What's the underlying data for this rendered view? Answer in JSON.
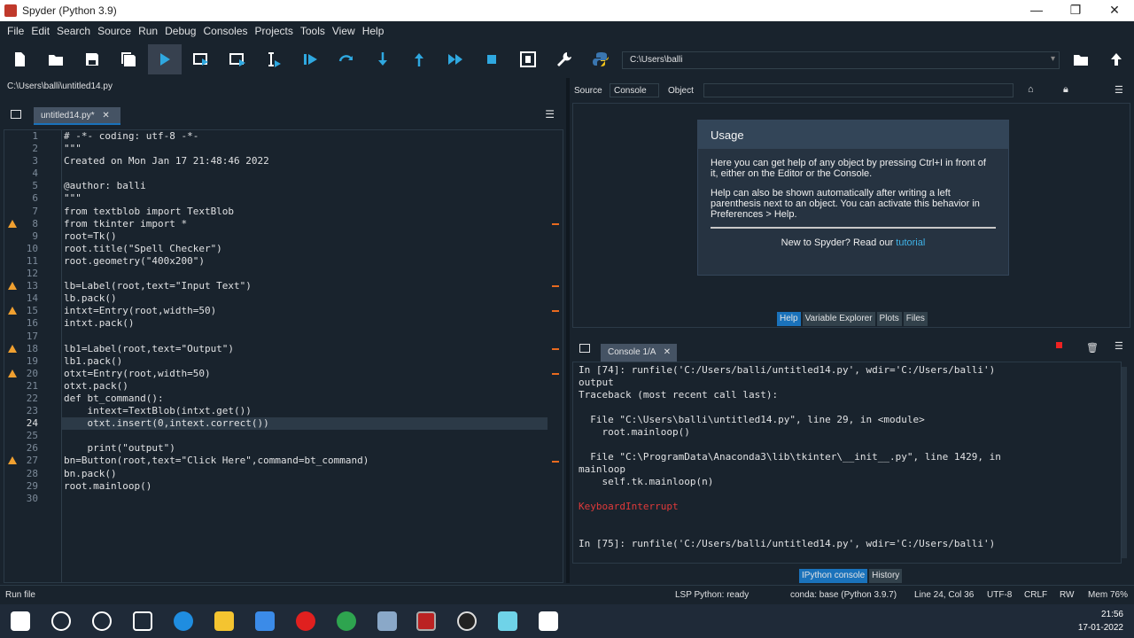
{
  "window": {
    "title": "Spyder (Python 3.9)",
    "minimize": "—",
    "maximize": "❐",
    "close": "✕"
  },
  "menu": [
    "File",
    "Edit",
    "Search",
    "Source",
    "Run",
    "Debug",
    "Consoles",
    "Projects",
    "Tools",
    "View",
    "Help"
  ],
  "toolbar": {
    "working_dir": "C:\\Users\\balli"
  },
  "editor": {
    "file_path": "C:\\Users\\balli\\untitled14.py",
    "tab_label": "untitled14.py*",
    "lines": [
      "# -*- coding: utf-8 -*-",
      "\"\"\"",
      "Created on Mon Jan 17 21:48:46 2022",
      "",
      "@author: balli",
      "\"\"\"",
      "from textblob import TextBlob",
      "from tkinter import *",
      "root=Tk()",
      "root.title(\"Spell Checker\")",
      "root.geometry(\"400x200\")",
      "",
      "lb=Label(root,text=\"Input Text\")",
      "lb.pack()",
      "intxt=Entry(root,width=50)",
      "intxt.pack()",
      "",
      "lb1=Label(root,text=\"Output\")",
      "lb1.pack()",
      "otxt=Entry(root,width=50)",
      "otxt.pack()",
      "def bt_command():",
      "    intext=TextBlob(intxt.get())",
      "    otxt.insert(0,intext.correct())",
      "",
      "    print(\"output\")",
      "bn=Button(root,text=\"Click Here\",command=bt_command)",
      "bn.pack()",
      "root.mainloop()",
      ""
    ]
  },
  "help": {
    "source_label": "Source",
    "source_value": "Console",
    "object_label": "Object",
    "usage_title": "Usage",
    "usage_p1": "Here you can get help of any object by pressing Ctrl+I in front of it, either on the Editor or the Console.",
    "usage_p2": "Help can also be shown automatically after writing a left parenthesis next to an object. You can activate this behavior in Preferences > Help.",
    "new_text": "New to Spyder? Read our ",
    "tutorial_link": "tutorial",
    "tabs": [
      "Help",
      "Variable Explorer",
      "Plots",
      "Files"
    ]
  },
  "console": {
    "tab_label": "Console 1/A",
    "lines": [
      "In [74]: runfile('C:/Users/balli/untitled14.py', wdir='C:/Users/balli')",
      "output",
      "Traceback (most recent call last):",
      "",
      "  File \"C:\\Users\\balli\\untitled14.py\", line 29, in <module>",
      "    root.mainloop()",
      "",
      "  File \"C:\\ProgramData\\Anaconda3\\lib\\tkinter\\__init__.py\", line 1429, in",
      "mainloop",
      "    self.tk.mainloop(n)",
      "",
      "KeyboardInterrupt",
      "",
      "",
      "In [75]: runfile('C:/Users/balli/untitled14.py', wdir='C:/Users/balli')"
    ],
    "tabs": [
      "IPython console",
      "History"
    ]
  },
  "status": {
    "left": "Run file",
    "lsp": "LSP Python: ready",
    "conda": "conda: base (Python 3.9.7)",
    "pos": "Line 24, Col 36",
    "enc": "UTF-8",
    "eol": "CRLF",
    "rw": "RW",
    "mem": "Mem 76%"
  },
  "taskbar": {
    "time": "21:56",
    "date": "17-01-2022"
  },
  "colors": {
    "bg": "#19232d",
    "accent": "#1a72bb",
    "warning": "#f0a030"
  }
}
